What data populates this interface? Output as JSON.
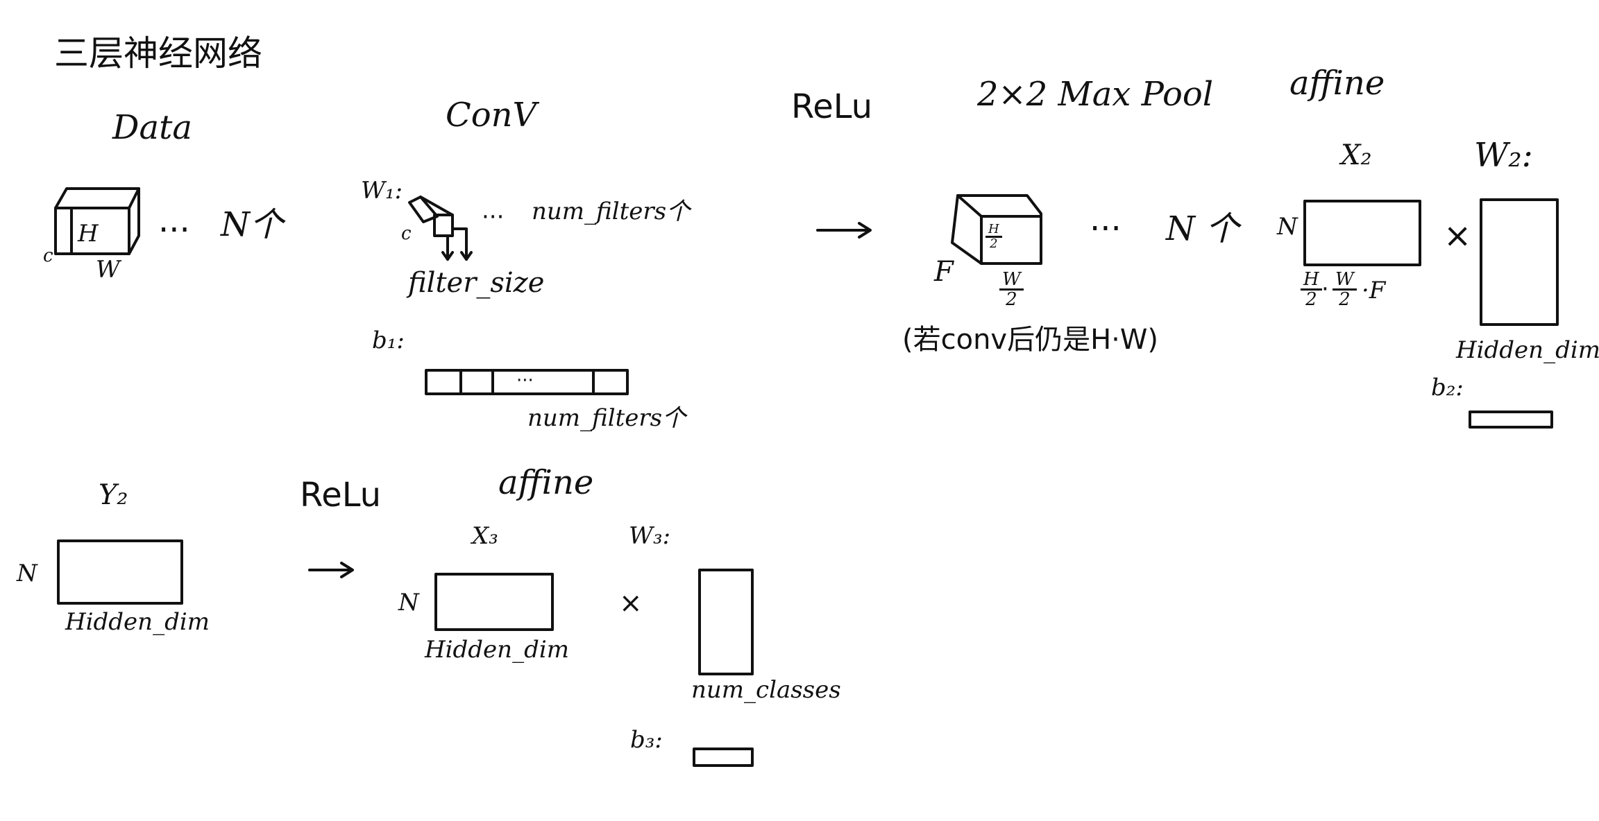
{
  "title": "三层神经网络",
  "top_row": {
    "data_label": "Data",
    "data_cube": {
      "depth": "c",
      "height": "H",
      "width": "W",
      "dots": "···",
      "count": "N个"
    },
    "conv_label": "ConV",
    "w1_label": "W₁:",
    "w1_depth": "c",
    "w1_dots": "···",
    "w1_count": "num_filters个",
    "filter_size": "filter_size",
    "b1_label": "b₁:",
    "b1_dots": "···",
    "b1_count": "num_filters个",
    "relu_label": "ReLu",
    "pool_label": "2×2 Max Pool",
    "pool_cube": {
      "depth": "F",
      "height_num": "H",
      "height_den": "2",
      "width_num": "W",
      "width_den": "2"
    },
    "pool_dots": "···",
    "pool_count": "N 个",
    "pool_note": "(若conv后仍是H·W)",
    "affine_label": "affine",
    "x2_label": "X₂",
    "x2_rows": "N",
    "x2_cols_a_num": "H",
    "x2_cols_a_den": "2",
    "x2_cols_b_num": "W",
    "x2_cols_b_den": "2",
    "x2_cols_tail": "·F",
    "times": "×",
    "w2_label": "W₂:",
    "w2_cols": "Hidden_dim",
    "b2_label": "b₂:"
  },
  "bottom_row": {
    "y2_label": "Y₂",
    "y2_rows": "N",
    "y2_cols": "Hidden_dim",
    "relu_label": "ReLu",
    "affine_label": "affine",
    "x3_label": "X₃",
    "x3_rows": "N",
    "x3_cols": "Hidden_dim",
    "times": "×",
    "w3_label": "W₃:",
    "w3_cols": "num_classes",
    "b3_label": "b₃:"
  }
}
